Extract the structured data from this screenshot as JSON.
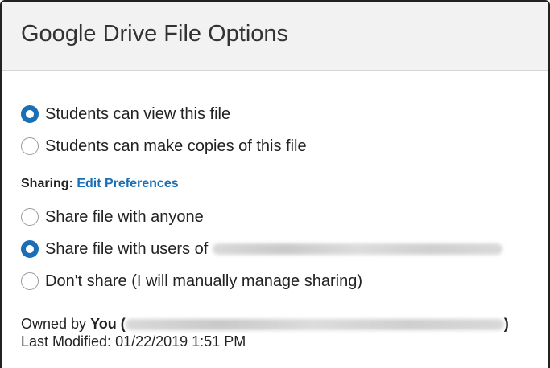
{
  "dialog": {
    "title": "Google Drive File Options"
  },
  "permissions": {
    "options": [
      {
        "label": "Students can view this file",
        "selected": true
      },
      {
        "label": "Students can make copies of this file",
        "selected": false
      }
    ]
  },
  "sharing": {
    "label": "Sharing:",
    "edit_link": "Edit Preferences",
    "options": [
      {
        "label": "Share file with anyone",
        "selected": false
      },
      {
        "label": "Share file with users of",
        "selected": true
      },
      {
        "label": "Don't share (I will manually manage sharing)",
        "selected": false
      }
    ]
  },
  "owner": {
    "prefix": "Owned by",
    "name": "You",
    "open_paren": "(",
    "close_paren": ")",
    "last_modified_label": "Last Modified:",
    "last_modified_value": "01/22/2019 1:51 PM"
  },
  "colors": {
    "accent": "#1a6fb5",
    "header_bg": "#f2f2f2"
  }
}
